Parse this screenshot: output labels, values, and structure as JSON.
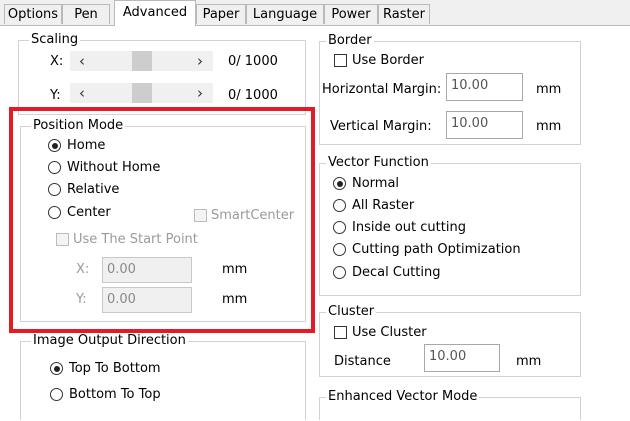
{
  "tabs": [
    "Options",
    "Pen",
    "Advanced",
    "Paper",
    "Language",
    "Power",
    "Raster"
  ],
  "scaling": {
    "title": "Scaling",
    "x_label": "X:",
    "y_label": "Y:",
    "x_value": "0/ 1000",
    "y_value": "0/ 1000",
    "left_arrow": "‹",
    "right_arrow": "›"
  },
  "position_mode": {
    "title": "Position Mode",
    "options": [
      "Home",
      "Without Home",
      "Relative",
      "Center"
    ],
    "selected": "Home",
    "smart_center": "SmartCenter",
    "use_start_point": "Use The Start Point",
    "x_label": "X:",
    "y_label": "Y:",
    "x_value": "0.00",
    "y_value": "0.00",
    "unit": "mm"
  },
  "image_output": {
    "title": "Image Output Direction",
    "options": [
      "Top To Bottom",
      "Bottom To Top"
    ],
    "selected": "Top To Bottom"
  },
  "border": {
    "title": "Border",
    "use_border": "Use Border",
    "horizontal_margin_label": "Horizontal Margin:",
    "horizontal_margin_value": "10.00",
    "vertical_margin_label": "Vertical Margin:",
    "vertical_margin_value": "10.00",
    "unit": "mm"
  },
  "vector_function": {
    "title": "Vector Function",
    "options": [
      "Normal",
      "All Raster",
      "Inside out cutting",
      "Cutting path Optimization",
      "Decal Cutting"
    ],
    "selected": "Normal"
  },
  "cluster": {
    "title": "Cluster",
    "use_cluster": "Use Cluster",
    "distance_label": "Distance",
    "distance_value": "10.00",
    "unit": "mm"
  },
  "enhanced": {
    "title": "Enhanced Vector Mode"
  },
  "colors": {
    "highlight": "#e21b24"
  }
}
